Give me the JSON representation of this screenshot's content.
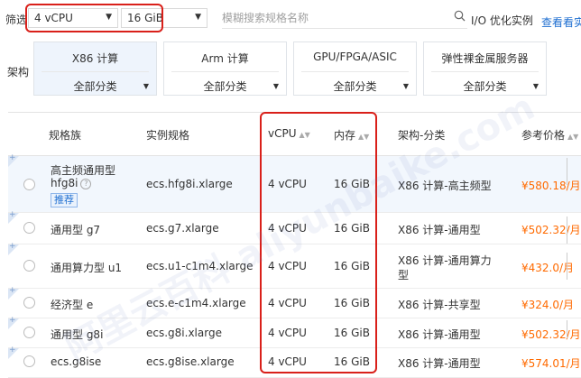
{
  "filter": {
    "label": "筛选",
    "vcpu": "4 vCPU",
    "memory": "16 GiB",
    "search_placeholder": "模糊搜索规格名称",
    "io_optimized": "I/O 优化实例",
    "compare_link": "查看看实"
  },
  "architecture": {
    "label": "架构",
    "cards": [
      {
        "title": "X86 计算",
        "sub": "全部分类"
      },
      {
        "title": "Arm 计算",
        "sub": "全部分类"
      },
      {
        "title": "GPU/FPGA/ASIC",
        "sub": "全部分类"
      },
      {
        "title": "弹性裸金属服务器",
        "sub": "全部分类"
      }
    ]
  },
  "table": {
    "headers": {
      "family": "规格族",
      "spec": "实例规格",
      "vcpu": "vCPU",
      "memory": "内存",
      "arch": "架构-分类",
      "price": "参考价格"
    },
    "rows": [
      {
        "family": "高主频通用型",
        "family2": "hfg8i",
        "badge": "推荐",
        "spec": "ecs.hfg8i.xlarge",
        "vcpu": "4 vCPU",
        "memory": "16 GiB",
        "arch": "X86 计算-高主频型",
        "price": "¥580.18/月"
      },
      {
        "family": "通用型 g7",
        "spec": "ecs.g7.xlarge",
        "vcpu": "4 vCPU",
        "memory": "16 GiB",
        "arch": "X86 计算-通用型",
        "price": "¥502.32/月"
      },
      {
        "family": "通用算力型 u1",
        "spec": "ecs.u1-c1m4.xlarge",
        "vcpu": "4 vCPU",
        "memory": "16 GiB",
        "arch": "X86 计算-通用算力",
        "arch2": "型",
        "price": "¥432.0/月"
      },
      {
        "family": "经济型 e",
        "spec": "ecs.e-c1m4.xlarge",
        "vcpu": "4 vCPU",
        "memory": "16 GiB",
        "arch": "X86 计算-共享型",
        "price": "¥324.0/月"
      },
      {
        "family": "通用型 g8i",
        "spec": "ecs.g8i.xlarge",
        "vcpu": "4 vCPU",
        "memory": "16 GiB",
        "arch": "X86 计算-通用型",
        "price": "¥502.32/月"
      },
      {
        "family": "ecs.g8ise",
        "spec": "ecs.g8ise.xlarge",
        "vcpu": "4 vCPU",
        "memory": "16 GiB",
        "arch": "X86 计算-通用型",
        "price": "¥574.01/月"
      }
    ]
  },
  "watermark": "阿里云百科 aliyunbaike.com",
  "colors": {
    "accent": "#1f6fd1",
    "price": "#ff6a00",
    "highlight": "#d9201a"
  }
}
